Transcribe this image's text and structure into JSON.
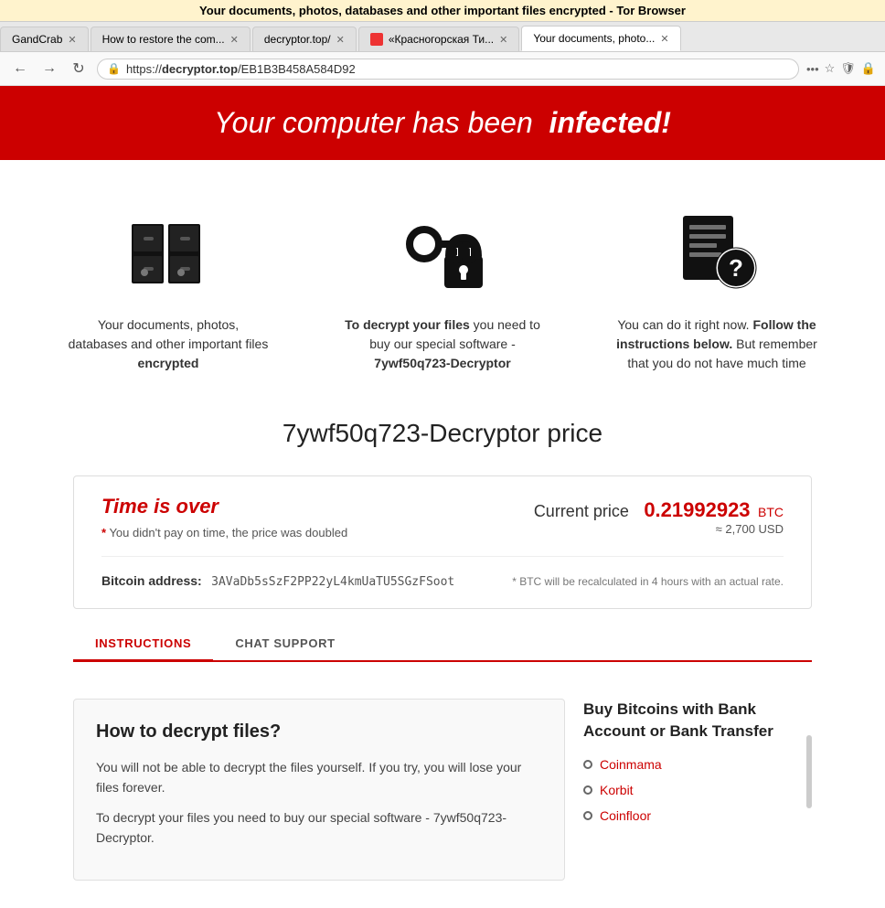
{
  "browser": {
    "notification": "Your documents, photos, databases and other important files encrypted - Tor Browser",
    "tabs": [
      {
        "id": "tab1",
        "label": "GandCrab",
        "favicon": false,
        "active": false
      },
      {
        "id": "tab2",
        "label": "How to restore the com...",
        "favicon": false,
        "active": false
      },
      {
        "id": "tab3",
        "label": "decryptor.top/",
        "favicon": false,
        "active": false
      },
      {
        "id": "tab4",
        "label": "«Красногорская Ти...",
        "favicon": true,
        "active": false
      },
      {
        "id": "tab5",
        "label": "Your documents, photo...",
        "favicon": false,
        "active": true
      }
    ],
    "url": "https://decryptor.top/EB1B3B458A584D92",
    "url_parts": {
      "protocol": "https://",
      "domain": "decryptor.top",
      "path": "/EB1B3B458A584D92"
    }
  },
  "page": {
    "banner": {
      "prefix": "Your computer has been",
      "highlight": "infected!"
    },
    "icons": [
      {
        "id": "files-icon",
        "text_html": "Your documents, photos, databases and other important files <strong>encrypted</strong>"
      },
      {
        "id": "key-lock-icon",
        "text_html": "<strong>To decrypt your files</strong> you need to buy our special software - <strong>7ywf50q723-Decryptor</strong>"
      },
      {
        "id": "document-question-icon",
        "text_html": "You can do it right now. <strong>Follow the instructions below.</strong> But remember that you do not have much time"
      }
    ],
    "price_section": {
      "title": "7ywf50q723-Decryptor price",
      "time_label": "Time is over",
      "note": "* You didn't pay on time, the price was doubled",
      "current_price_label": "Current price",
      "current_price_value": "0.21992923",
      "currency": "BTC",
      "usd_approx": "≈ 2,700 USD",
      "bitcoin_address_label": "Bitcoin address:",
      "bitcoin_address_value": "3AVaDb5sSzF2PP22yL4kmUaTU5SGzFSoot",
      "recalc_note": "* BTC will be recalculated in 4 hours with an actual rate."
    },
    "tabs": [
      {
        "id": "instructions",
        "label": "INSTRUCTIONS",
        "active": true
      },
      {
        "id": "chat-support",
        "label": "CHAT SUPPORT",
        "active": false
      }
    ],
    "instructions": {
      "title": "How to decrypt files?",
      "para1": "You will not be able to decrypt the files yourself. If you try, you will lose your files forever.",
      "para2": "To decrypt your files you need to buy our special software - 7ywf50q723-Decryptor."
    },
    "buy_btc": {
      "title": "Buy Bitcoins with Bank Account or Bank Transfer",
      "services": [
        {
          "name": "Coinmama",
          "url": "#"
        },
        {
          "name": "Korbit",
          "url": "#"
        },
        {
          "name": "Coinfloor",
          "url": "#"
        }
      ]
    }
  }
}
